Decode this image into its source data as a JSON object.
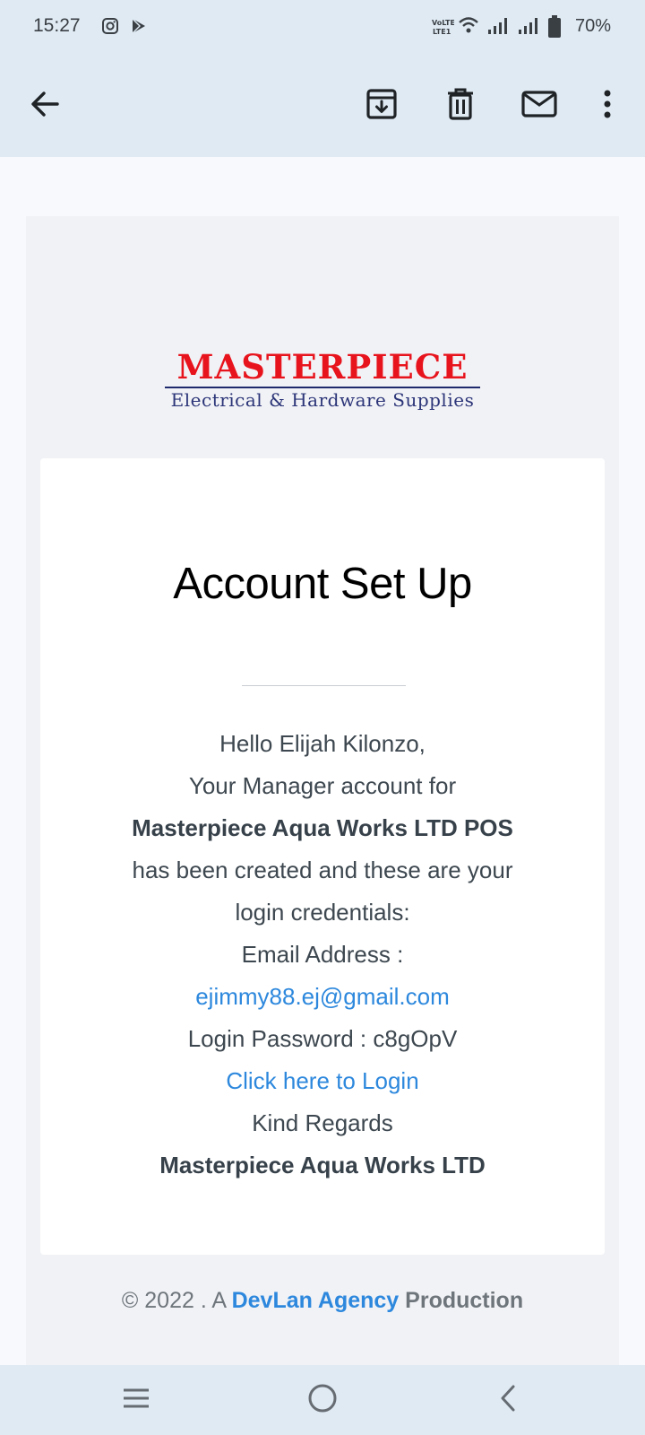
{
  "status_bar": {
    "time": "15:27",
    "battery_percent": "70%",
    "network_label": "VoLTE1",
    "icons": [
      "instagram-icon",
      "play-store-icon",
      "volte-icon",
      "wifi-icon",
      "signal-icon",
      "signal-icon",
      "battery-icon"
    ]
  },
  "toolbar": {
    "back": "back-arrow-icon",
    "actions": [
      "archive-icon",
      "delete-icon",
      "mark-unread-icon",
      "more-icon"
    ]
  },
  "email": {
    "logo": {
      "title": "MASTERPIECE",
      "subtitle": "Electrical & Hardware Supplies"
    },
    "title": "Account Set Up",
    "greeting": "Hello Elijah Kilonzo,",
    "line1": "Your Manager account for",
    "business_name": "Masterpiece Aqua Works LTD POS",
    "line2": "has been created and these are your",
    "line3": "login credentials:",
    "email_label": "Email Address :",
    "email_value": "ejimmy88.ej@gmail.com",
    "password_line": "Login Password : c8gOpV",
    "login_link": "Click here to Login",
    "regards": "Kind Regards",
    "signature": "Masterpiece Aqua Works LTD",
    "footer": {
      "prefix": "© 2022 . A ",
      "link": "DevLan Agency",
      "suffix": " Production"
    }
  },
  "colors": {
    "top_bar": "#dfeaf3",
    "link": "#2d88dd",
    "logo_red": "#e8141d",
    "logo_blue": "#2c3578"
  }
}
